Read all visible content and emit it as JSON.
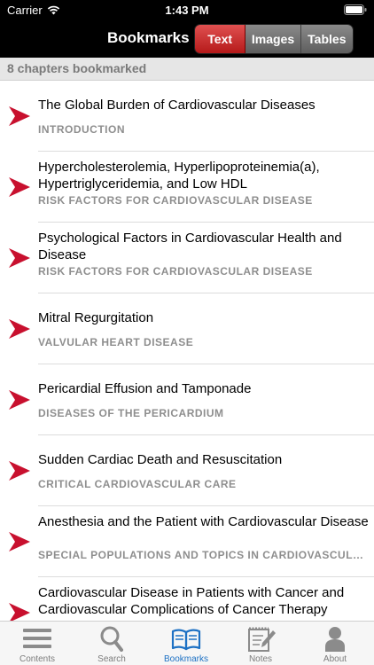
{
  "status": {
    "carrier": "Carrier",
    "time": "1:43 PM"
  },
  "nav": {
    "title": "Bookmarks",
    "segments": [
      "Text",
      "Images",
      "Tables"
    ],
    "selected_segment": "Text"
  },
  "section_header": "8 chapters bookmarked",
  "bookmarks": [
    {
      "title": "The Global Burden of Cardiovascular Diseases",
      "section": "INTRODUCTION"
    },
    {
      "title": "Hypercholesterolemia, Hyperlipoproteinemia(a), Hypertriglyceridemia, and Low HDL",
      "section": "RISK FACTORS FOR CARDIOVASCULAR DISEASE"
    },
    {
      "title": "Psychological Factors in Cardiovascular Health and Disease",
      "section": "RISK FACTORS FOR CARDIOVASCULAR DISEASE"
    },
    {
      "title": "Mitral Regurgitation",
      "section": "VALVULAR HEART DISEASE"
    },
    {
      "title": "Pericardial Effusion and Tamponade",
      "section": "DISEASES OF THE PERICARDIUM"
    },
    {
      "title": "Sudden Cardiac Death and Resuscitation",
      "section": "CRITICAL CARDIOVASCULAR CARE"
    },
    {
      "title": "Anesthesia and the Patient with Cardiovascular Disease",
      "section": "SPECIAL POPULATIONS AND TOPICS IN CARDIOVASCULAR DISEASE"
    },
    {
      "title": "Cardiovascular Disease in Patients with Cancer and Cardiovascular Complications of Cancer Therapy",
      "section": ""
    }
  ],
  "tabs": [
    {
      "label": "Contents",
      "icon": "list-icon"
    },
    {
      "label": "Search",
      "icon": "magnifier-icon"
    },
    {
      "label": "Bookmarks",
      "icon": "open-book-icon"
    },
    {
      "label": "Notes",
      "icon": "notepad-pencil-icon"
    },
    {
      "label": "About",
      "icon": "person-icon"
    }
  ],
  "colors": {
    "accent_red": "#c8102e",
    "tab_active": "#1d71c4"
  }
}
